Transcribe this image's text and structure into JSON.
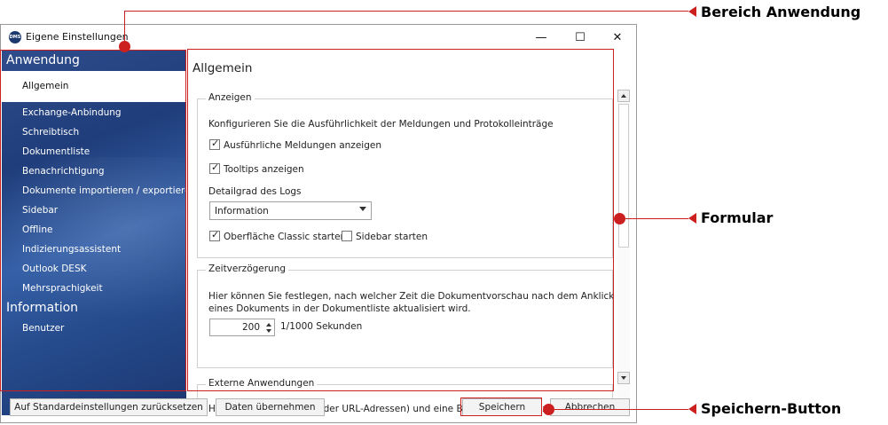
{
  "window": {
    "title": "Eigene Einstellungen",
    "icon_label": "DMS",
    "controls": {
      "minimize": "—",
      "maximize": "☐",
      "close": "✕"
    }
  },
  "sidebar": {
    "heading_application": "Anwendung",
    "heading_information": "Information",
    "selected_item": "Allgemein",
    "items": [
      "Exchange-Anbindung",
      "Schreibtisch",
      "Dokumentliste",
      "Benachrichtigung",
      "Dokumente importieren / exportieren",
      "Sidebar",
      "Offline",
      "Indizierungsassistent",
      "Outlook DESK",
      "Mehrsprachigkeit"
    ],
    "info_items": [
      "Benutzer"
    ]
  },
  "content": {
    "title": "Allgemein",
    "anzeigen": {
      "label": "Anzeigen",
      "description": "Konfigurieren Sie die Ausführlichkeit der Meldungen und Protokolleinträge",
      "checkbox_verbose": "Ausführliche Meldungen anzeigen",
      "checkbox_tooltips": "Tooltips anzeigen",
      "log_label": "Detailgrad des Logs",
      "log_value": "Information",
      "checkbox_classic": "Oberfläche Classic starten",
      "checkbox_sidebar": "Sidebar starten"
    },
    "zeit": {
      "label": "Zeitverzögerung",
      "description_1": "Hier können Sie festlegen, nach welcher Zeit die Dokumentvorschau nach dem Anklicken",
      "description_2": "eines Dokuments in der Dokumentliste aktualisiert wird.",
      "value": "200",
      "unit": "1/1000 Sekunden"
    },
    "extern": {
      "label": "Externe Anwendungen",
      "description": "Hier können Sie Pfade (oder URL-Adressen) und eine Beschreibung zu externen"
    }
  },
  "footer": {
    "reset": "Auf Standardeinstellungen zurücksetzen",
    "apply": "Daten übernehmen",
    "save": "Speichern",
    "cancel": "Abbrechen"
  },
  "annotations": {
    "area": "Bereich Anwendung",
    "form": "Formular",
    "save": "Speichern-Button"
  },
  "colors": {
    "accent": "#cc1f1f",
    "sidebar": "#264b8c"
  }
}
